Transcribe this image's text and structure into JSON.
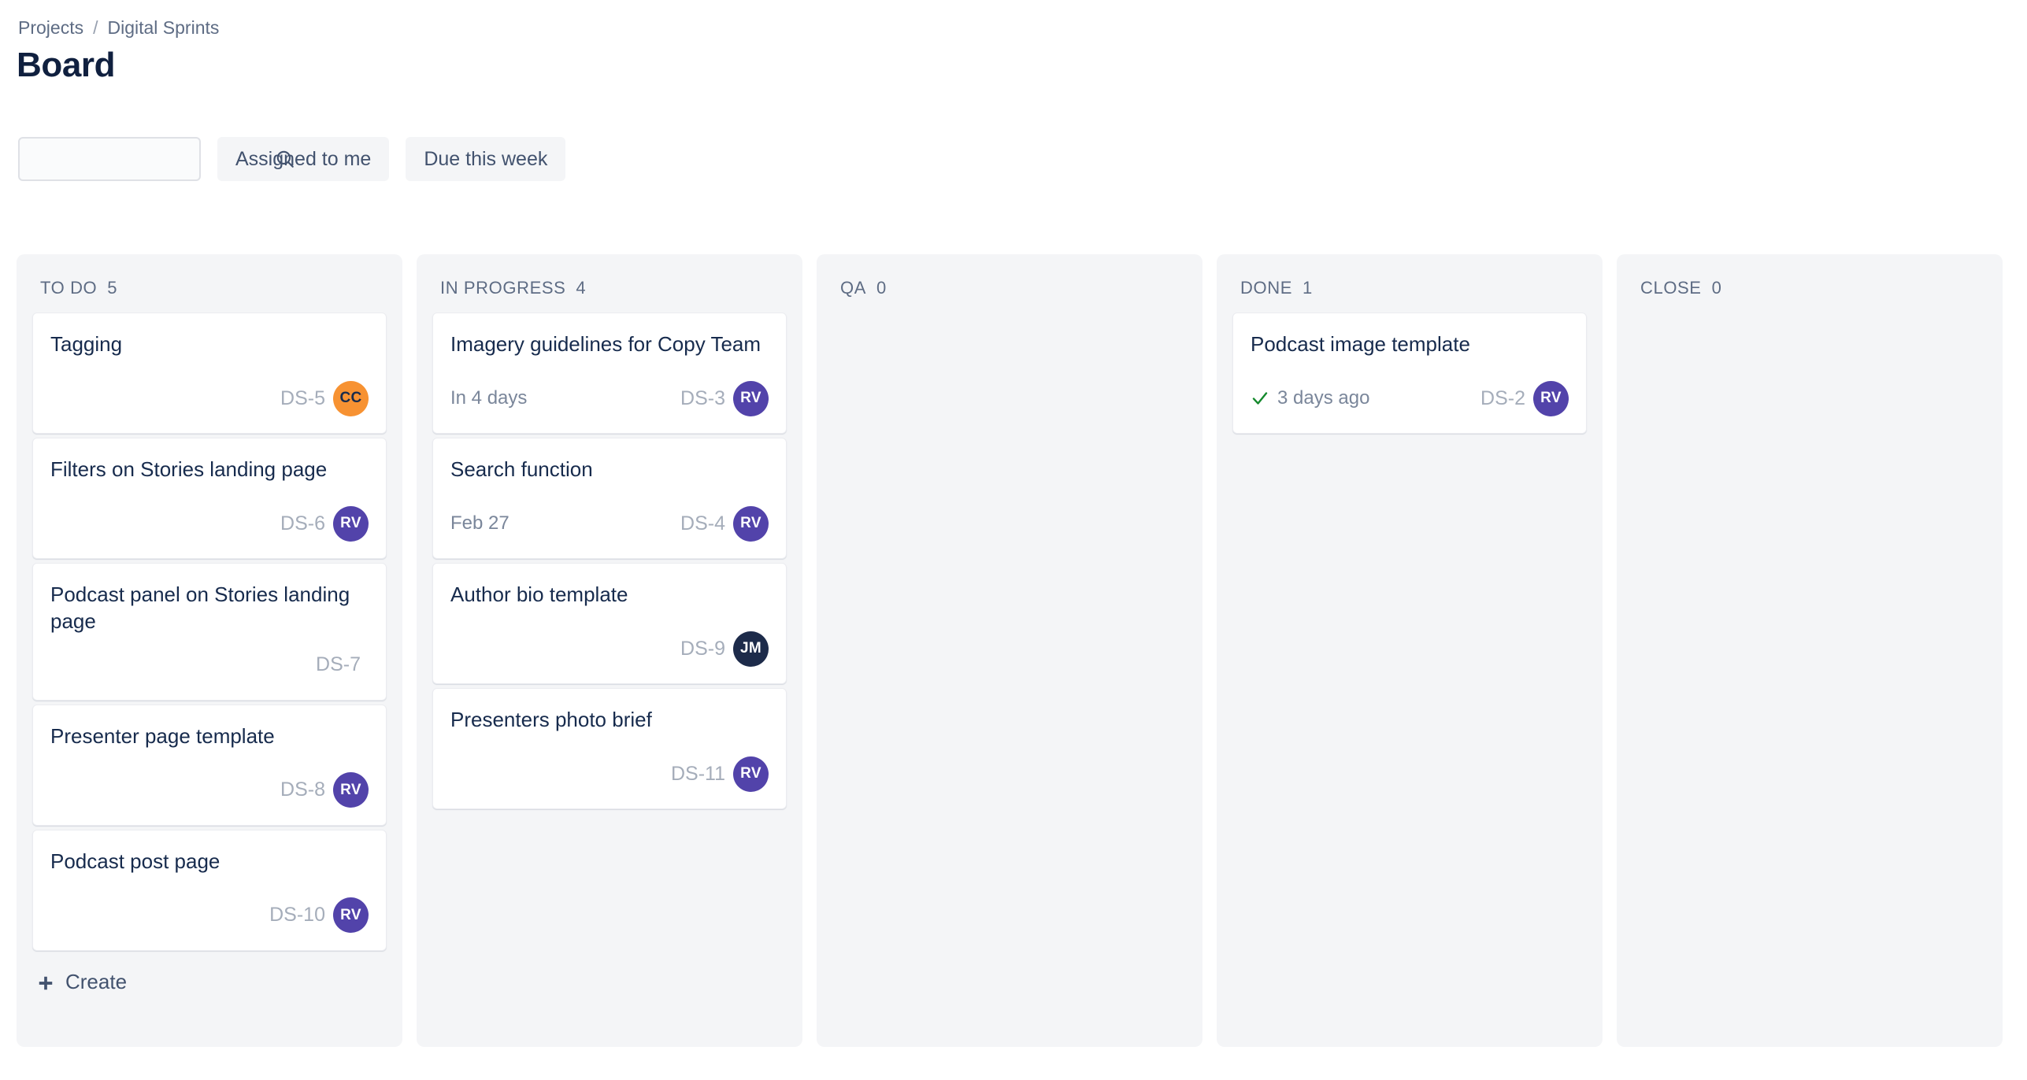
{
  "breadcrumb": {
    "root": "Projects",
    "separator": "/",
    "project": "Digital Sprints"
  },
  "header": {
    "title": "Board"
  },
  "toolbar": {
    "search": {
      "value": "",
      "placeholder": "",
      "icon": "search-icon"
    },
    "filters": [
      {
        "label": "Assigned to me"
      },
      {
        "label": "Due this week"
      }
    ]
  },
  "colors": {
    "page_background": "#FFFFFF",
    "column_background": "#F4F5F7",
    "card_background": "#FFFFFF",
    "title_text": "#10203F",
    "body_text": "#172B4D",
    "muted_text": "#5E6C84",
    "key_text": "#A5ADBA",
    "avatar_purple": "#5243AA",
    "avatar_orange": "#F79232",
    "avatar_navy": "#1D2B4A",
    "done_check_green": "#14892C",
    "filter_button_bg": "#F4F5F7"
  },
  "board": {
    "columns": [
      {
        "name": "TO DO",
        "count": "5",
        "show_create": true,
        "create_label": "Create",
        "cards": [
          {
            "title": "Tagging",
            "due": "",
            "done": false,
            "key": "DS-5",
            "avatar": {
              "initials": "CC",
              "color": "#F79232",
              "text_color": "#172B4D"
            }
          },
          {
            "title": "Filters on Stories landing page",
            "due": "",
            "done": false,
            "key": "DS-6",
            "avatar": {
              "initials": "RV",
              "color": "#5243AA",
              "text_color": "#FFFFFF"
            }
          },
          {
            "title": "Podcast panel on Stories landing page",
            "due": "",
            "done": false,
            "key": "DS-7",
            "avatar": null
          },
          {
            "title": "Presenter page template",
            "due": "",
            "done": false,
            "key": "DS-8",
            "avatar": {
              "initials": "RV",
              "color": "#5243AA",
              "text_color": "#FFFFFF"
            }
          },
          {
            "title": "Podcast post page",
            "due": "",
            "done": false,
            "key": "DS-10",
            "avatar": {
              "initials": "RV",
              "color": "#5243AA",
              "text_color": "#FFFFFF"
            }
          }
        ]
      },
      {
        "name": "IN PROGRESS",
        "count": "4",
        "show_create": false,
        "create_label": "",
        "cards": [
          {
            "title": "Imagery guidelines for Copy Team",
            "due": "In 4 days",
            "done": false,
            "key": "DS-3",
            "avatar": {
              "initials": "RV",
              "color": "#5243AA",
              "text_color": "#FFFFFF"
            }
          },
          {
            "title": "Search function",
            "due": "Feb 27",
            "done": false,
            "key": "DS-4",
            "avatar": {
              "initials": "RV",
              "color": "#5243AA",
              "text_color": "#FFFFFF"
            }
          },
          {
            "title": "Author bio template",
            "due": "",
            "done": false,
            "key": "DS-9",
            "avatar": {
              "initials": "JM",
              "color": "#1D2B4A",
              "text_color": "#FFFFFF"
            }
          },
          {
            "title": "Presenters photo brief",
            "due": "",
            "done": false,
            "key": "DS-11",
            "avatar": {
              "initials": "RV",
              "color": "#5243AA",
              "text_color": "#FFFFFF"
            }
          }
        ]
      },
      {
        "name": "QA",
        "count": "0",
        "show_create": false,
        "create_label": "",
        "cards": []
      },
      {
        "name": "DONE",
        "count": "1",
        "show_create": false,
        "create_label": "",
        "cards": [
          {
            "title": "Podcast image template",
            "due": "3 days ago",
            "done": true,
            "key": "DS-2",
            "avatar": {
              "initials": "RV",
              "color": "#5243AA",
              "text_color": "#FFFFFF"
            }
          }
        ]
      },
      {
        "name": "CLOSE",
        "count": "0",
        "show_create": false,
        "create_label": "",
        "cards": []
      }
    ]
  }
}
